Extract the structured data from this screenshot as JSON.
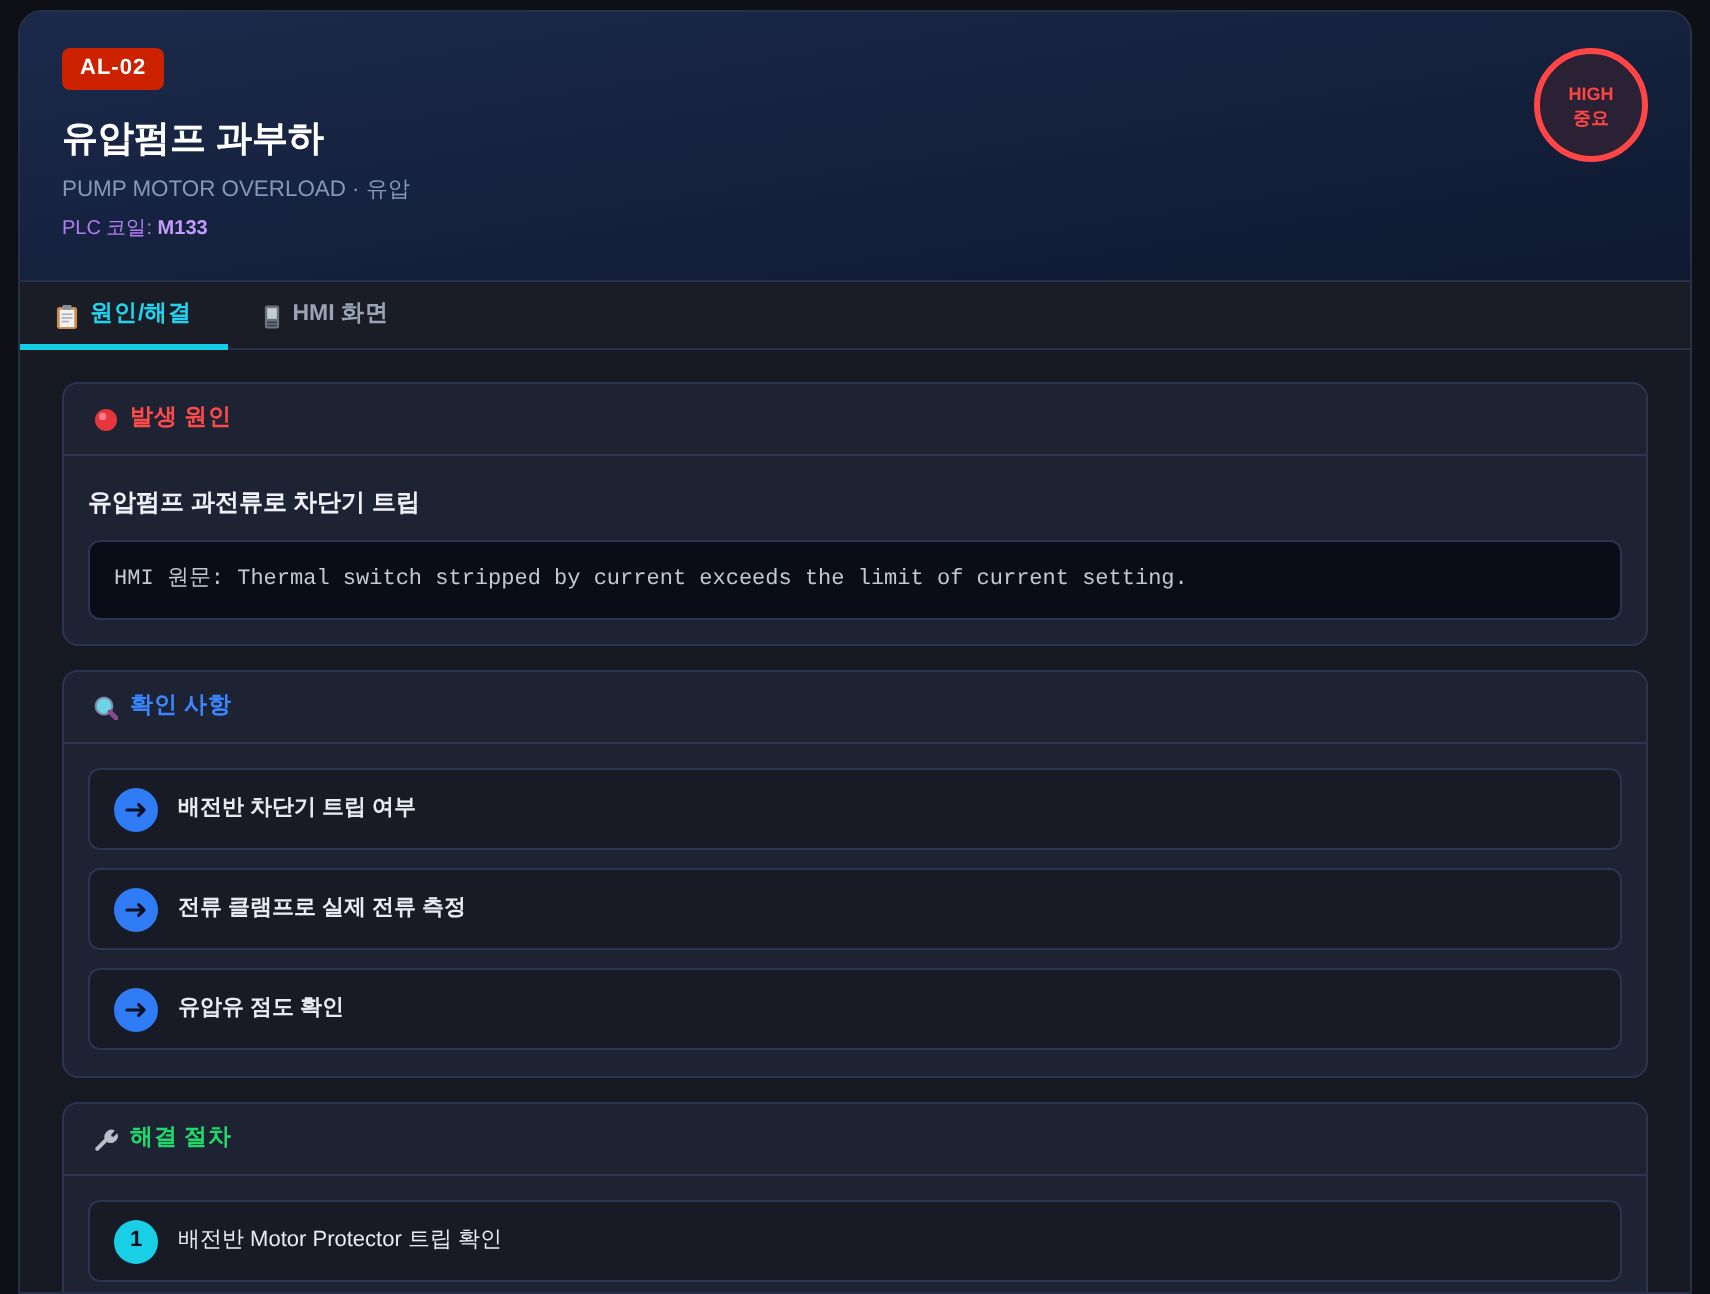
{
  "alarm": {
    "code": "AL-02",
    "title": "유압펌프 과부하",
    "subtitle": "PUMP MOTOR OVERLOAD · 유압",
    "plc_label": "PLC 코일:",
    "plc_value": "M133",
    "severity": {
      "kind": "high",
      "code": "HIGH",
      "label": "중요"
    }
  },
  "tabs": [
    {
      "label": "원인/해결",
      "selected": true
    },
    {
      "label": "HMI 화면",
      "selected": false
    }
  ],
  "sections": [
    {
      "kind": "cause",
      "title": "발생 원인",
      "headline": "유압펌프 과전류로 차단기 트립",
      "hmi_label": "HMI 원문:",
      "hmi_text": "Thermal switch stripped by current exceeds the limit of current setting."
    },
    {
      "kind": "checks",
      "title": "확인 사항",
      "items": [
        "배전반 차단기 트립 여부",
        "전류 클램프로 실제 전류 측정",
        "유압유 점도 확인"
      ]
    },
    {
      "kind": "steps",
      "title": "해결 절차",
      "items": [
        {
          "number": "1",
          "text": "배전반 Motor Protector 트립 확인"
        }
      ]
    }
  ]
}
